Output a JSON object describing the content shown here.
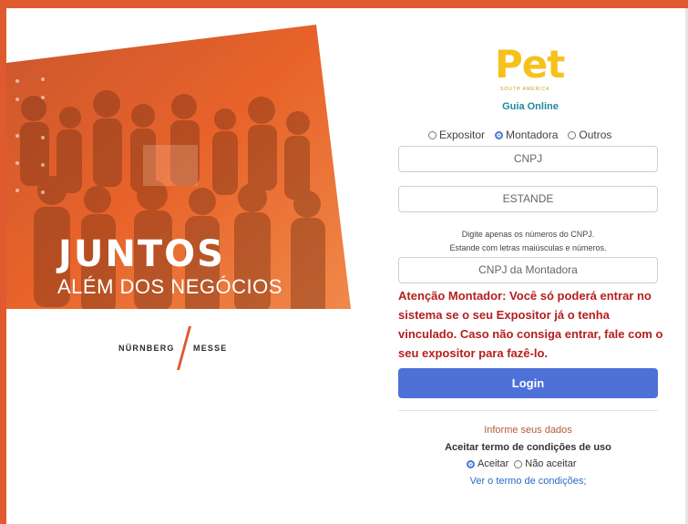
{
  "hero": {
    "title": "JUNTOS",
    "subtitle": "ALÉM DOS NEGÓCIOS",
    "overlay_color": "#e8632a"
  },
  "partner_logo": {
    "left_word": "NÜRNBERG",
    "right_word": "MESSE"
  },
  "brand": {
    "logo_word": "Pet",
    "logo_subtext": "SOUTH AMERICA",
    "guia_label": "Guia Online",
    "logo_color": "#f5c21b"
  },
  "role_options": {
    "items": [
      {
        "label": "Expositor",
        "selected": false
      },
      {
        "label": "Montadora",
        "selected": true
      },
      {
        "label": "Outros",
        "selected": false
      }
    ]
  },
  "form": {
    "cnpj_placeholder": "CNPJ",
    "estande_placeholder": "ESTANDE",
    "hint_line1": "Digite apenas os números do CNPJ.",
    "hint_line2": "Estande com letras maiúsculas e números.",
    "cnpj_montadora_placeholder": "CNPJ da Montadora",
    "warning_text": "Atenção Montador: Você só poderá entrar no sistema se o seu Expositor já o tenha vinculado. Caso não consiga entrar, fale com o seu expositor para fazê-lo.",
    "login_label": "Login",
    "accent_color": "#4d71d7"
  },
  "terms": {
    "informe": "Informe seus dados",
    "title": "Aceitar termo de condições de uso",
    "accept_label": "Aceitar",
    "reject_label": "Não aceitar",
    "accepted": true,
    "link_label": "Ver o termo de condições;"
  }
}
